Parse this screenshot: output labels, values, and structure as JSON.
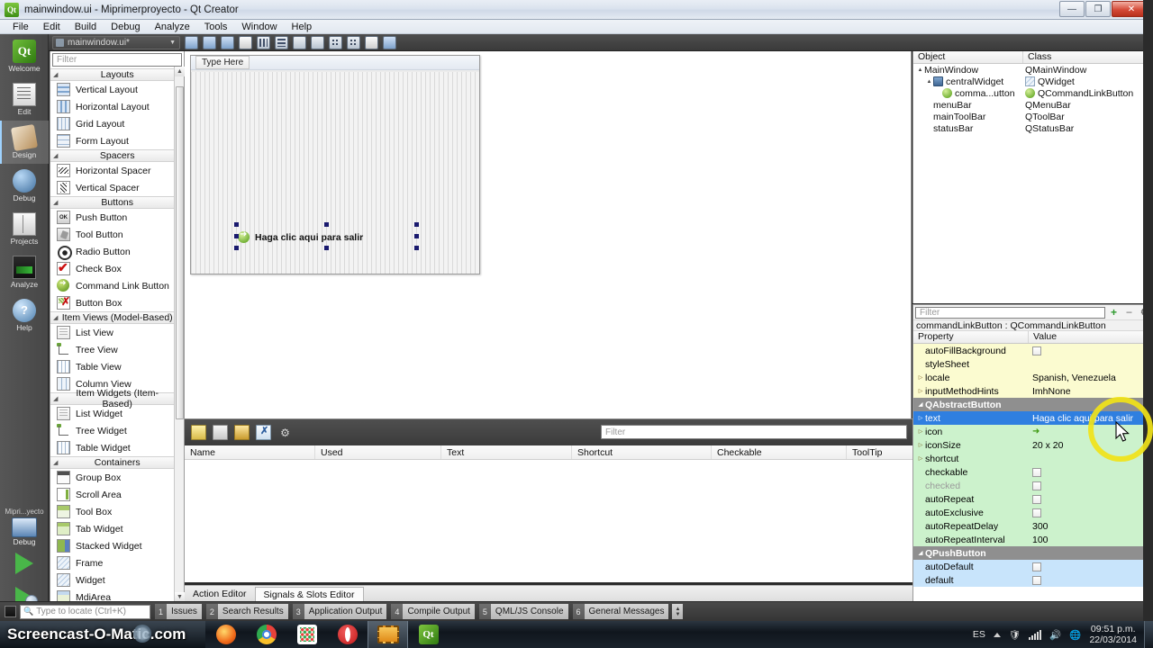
{
  "window": {
    "title": "mainwindow.ui - Miprimerproyecto - Qt Creator",
    "app_icon": "Qt",
    "minimize": "—",
    "maximize": "❐",
    "close": "✕"
  },
  "menubar": {
    "items": [
      "File",
      "Edit",
      "Build",
      "Debug",
      "Analyze",
      "Tools",
      "Window",
      "Help"
    ]
  },
  "editor_toolbar": {
    "file_combo": "mainwindow.ui*",
    "dropdown_arrow": "▼",
    "icons": [
      "adjust-size-icon",
      "lay-out-size-icon",
      "break-layout-icon",
      "save-form-icon",
      "layout-horizontally-icon",
      "layout-vertically-icon",
      "layout-splitter-h-icon",
      "layout-splitter-v-icon",
      "layout-form-icon",
      "layout-grid-icon",
      "preview-icon",
      "edit-widgets-icon"
    ]
  },
  "modebar": {
    "items": [
      {
        "label": "Welcome",
        "icon": "qt-logo-icon",
        "active": false
      },
      {
        "label": "Edit",
        "icon": "document-icon",
        "active": false
      },
      {
        "label": "Design",
        "icon": "brush-icon",
        "active": true
      },
      {
        "label": "Debug",
        "icon": "debug-sphere-icon",
        "active": false
      },
      {
        "label": "Projects",
        "icon": "projects-book-icon",
        "active": false
      },
      {
        "label": "Analyze",
        "icon": "analyze-chart-icon",
        "active": false
      },
      {
        "label": "Help",
        "icon": "help-question-icon",
        "active": false
      }
    ],
    "kit_label": "Mipri...yecto",
    "build_config": "Debug",
    "run_button": "run-icon",
    "debug_button": "start-debugging-icon",
    "build_button": "build-hammer-icon"
  },
  "widget_box": {
    "filter_placeholder": "Filter",
    "sections": [
      {
        "name": "Layouts",
        "items": [
          {
            "label": "Vertical Layout",
            "icon": "vertical-layout-icon",
            "cls": "vlay"
          },
          {
            "label": "Horizontal Layout",
            "icon": "horizontal-layout-icon",
            "cls": "hlay"
          },
          {
            "label": "Grid Layout",
            "icon": "grid-layout-icon",
            "cls": "grid"
          },
          {
            "label": "Form Layout",
            "icon": "form-layout-icon",
            "cls": "form"
          }
        ]
      },
      {
        "name": "Spacers",
        "items": [
          {
            "label": "Horizontal Spacer",
            "icon": "horizontal-spacer-icon",
            "cls": "hsp"
          },
          {
            "label": "Vertical Spacer",
            "icon": "vertical-spacer-icon",
            "cls": "vsp"
          }
        ]
      },
      {
        "name": "Buttons",
        "items": [
          {
            "label": "Push Button",
            "icon": "push-button-icon",
            "cls": "push",
            "glyph": "OK"
          },
          {
            "label": "Tool Button",
            "icon": "tool-button-icon",
            "cls": "tool"
          },
          {
            "label": "Radio Button",
            "icon": "radio-button-icon",
            "cls": "radio"
          },
          {
            "label": "Check Box",
            "icon": "check-box-icon",
            "cls": "check"
          },
          {
            "label": "Command Link Button",
            "icon": "command-link-button-icon",
            "cls": "cmd"
          },
          {
            "label": "Button Box",
            "icon": "button-box-icon",
            "cls": "bbox"
          }
        ]
      },
      {
        "name": "Item Views (Model-Based)",
        "left_aligned": true,
        "items": [
          {
            "label": "List View",
            "icon": "list-view-icon",
            "cls": "listv"
          },
          {
            "label": "Tree View",
            "icon": "tree-view-icon",
            "cls": "treev"
          },
          {
            "label": "Table View",
            "icon": "table-view-icon",
            "cls": "tablev"
          },
          {
            "label": "Column View",
            "icon": "column-view-icon",
            "cls": "colv"
          }
        ]
      },
      {
        "name": "Item Widgets (Item-Based)",
        "left_aligned": true,
        "items": [
          {
            "label": "List Widget",
            "icon": "list-widget-icon",
            "cls": "listv"
          },
          {
            "label": "Tree Widget",
            "icon": "tree-widget-icon",
            "cls": "treev"
          },
          {
            "label": "Table Widget",
            "icon": "table-widget-icon",
            "cls": "tablev"
          }
        ]
      },
      {
        "name": "Containers",
        "items": [
          {
            "label": "Group Box",
            "icon": "group-box-icon",
            "cls": "gbox"
          },
          {
            "label": "Scroll Area",
            "icon": "scroll-area-icon",
            "cls": "scroll"
          },
          {
            "label": "Tool Box",
            "icon": "tool-box-icon",
            "cls": "tbox"
          },
          {
            "label": "Tab Widget",
            "icon": "tab-widget-icon",
            "cls": "tabw"
          },
          {
            "label": "Stacked Widget",
            "icon": "stacked-widget-icon",
            "cls": "stackw"
          },
          {
            "label": "Frame",
            "icon": "frame-icon",
            "cls": "frame"
          },
          {
            "label": "Widget",
            "icon": "widget-icon",
            "cls": "frame"
          },
          {
            "label": "MdiArea",
            "icon": "mdi-area-icon",
            "cls": "mdi"
          }
        ]
      }
    ]
  },
  "designer": {
    "form_menu_placeholder": "Type Here",
    "command_link_button": {
      "text": "Haga clic aqui para salir",
      "icon": "green-arrow-icon",
      "selected": true
    }
  },
  "object_inspector": {
    "headers": [
      "Object",
      "Class"
    ],
    "rows": [
      {
        "object": "MainWindow",
        "cls": "QMainWindow",
        "indent": 0,
        "twisty": "▲",
        "icon": ""
      },
      {
        "object": "centralWidget",
        "cls": "QWidget",
        "indent": 1,
        "twisty": "▲",
        "icon": "cw"
      },
      {
        "object": "comma...utton",
        "cls": "QCommandLinkButton",
        "indent": 2,
        "twisty": "",
        "icon": "cmd"
      },
      {
        "object": "menuBar",
        "cls": "QMenuBar",
        "indent": 1,
        "twisty": "",
        "icon": ""
      },
      {
        "object": "mainToolBar",
        "cls": "QToolBar",
        "indent": 1,
        "twisty": "",
        "icon": ""
      },
      {
        "object": "statusBar",
        "cls": "QStatusBar",
        "indent": 1,
        "twisty": "",
        "icon": ""
      }
    ]
  },
  "property_editor": {
    "filter_placeholder": "Filter",
    "add_button": "+",
    "remove_button": "−",
    "configure_button": "⚙",
    "object_line": "commandLinkButton : QCommandLinkButton",
    "headers": [
      "Property",
      "Value"
    ],
    "rows": [
      {
        "name": "autoFillBackground",
        "value": "",
        "style": "yellow",
        "expand": false,
        "checkbox": true
      },
      {
        "name": "styleSheet",
        "value": "",
        "style": "yellow",
        "expand": false
      },
      {
        "name": "locale",
        "value": "Spanish, Venezuela",
        "style": "yellow",
        "expand": true
      },
      {
        "name": "inputMethodHints",
        "value": "ImhNone",
        "style": "yellow",
        "expand": true
      },
      {
        "name": "QAbstractButton",
        "value": "",
        "style": "group",
        "expand": true
      },
      {
        "name": "text",
        "value": "Haga clic aqui para salir",
        "style": "sel",
        "expand": true
      },
      {
        "name": "icon",
        "value": "",
        "style": "green",
        "expand": true,
        "arrow_icon": true
      },
      {
        "name": "iconSize",
        "value": "20 x 20",
        "style": "green",
        "expand": true
      },
      {
        "name": "shortcut",
        "value": "",
        "style": "green",
        "expand": true
      },
      {
        "name": "checkable",
        "value": "",
        "style": "green",
        "expand": false,
        "checkbox": true
      },
      {
        "name": "checked",
        "value": "",
        "style": "green dim",
        "expand": false,
        "checkbox": true
      },
      {
        "name": "autoRepeat",
        "value": "",
        "style": "green",
        "expand": false,
        "checkbox": true
      },
      {
        "name": "autoExclusive",
        "value": "",
        "style": "green",
        "expand": false,
        "checkbox": true
      },
      {
        "name": "autoRepeatDelay",
        "value": "300",
        "style": "green",
        "expand": false
      },
      {
        "name": "autoRepeatInterval",
        "value": "100",
        "style": "green",
        "expand": false
      },
      {
        "name": "QPushButton",
        "value": "",
        "style": "group",
        "expand": true
      },
      {
        "name": "autoDefault",
        "value": "",
        "style": "blue",
        "expand": false,
        "checkbox": true
      },
      {
        "name": "default",
        "value": "",
        "style": "blue",
        "expand": false,
        "checkbox": true
      }
    ]
  },
  "action_editor": {
    "toolbar_icons": [
      "new-action-icon",
      "copy-action-icon",
      "cut-action-icon",
      "delete-action-icon",
      "configure-icon"
    ],
    "filter_placeholder": "Filter",
    "headers": [
      "Name",
      "Used",
      "Text",
      "Shortcut",
      "Checkable",
      "ToolTip"
    ],
    "rows": [],
    "tabs": [
      {
        "label": "Action Editor",
        "active": true
      },
      {
        "label": "Signals & Slots Editor",
        "active": false
      }
    ]
  },
  "output_bar": {
    "locate_placeholder": "Type to locate (Ctrl+K)",
    "search_icon": "magnifier-icon",
    "panes": [
      {
        "num": "1",
        "label": "Issues"
      },
      {
        "num": "2",
        "label": "Search Results"
      },
      {
        "num": "3",
        "label": "Application Output"
      },
      {
        "num": "4",
        "label": "Compile Output"
      },
      {
        "num": "5",
        "label": "QML/JS Console"
      },
      {
        "num": "6",
        "label": "General Messages"
      }
    ]
  },
  "taskbar": {
    "watermark": "Screencast-O-Matic.com",
    "apps": [
      {
        "name": "firefox-icon",
        "cls": "ic-firefox",
        "active": false
      },
      {
        "name": "chrome-icon",
        "cls": "ic-chrome",
        "active": false
      },
      {
        "name": "apps-icon",
        "cls": "ic-apps",
        "active": false
      },
      {
        "name": "opera-icon",
        "cls": "ic-opera",
        "active": false
      },
      {
        "name": "screencast-o-matic-icon",
        "cls": "ic-som",
        "active": true
      },
      {
        "name": "qt-creator-icon",
        "cls": "ic-qt",
        "active": false
      }
    ],
    "tray": {
      "language": "ES",
      "show_hidden": "▲",
      "icons": [
        "action-center-icon",
        "network-icon",
        "volume-icon",
        "update-icon"
      ],
      "time": "09:51 p.m.",
      "date": "22/03/2014"
    }
  },
  "colors": {
    "accent_selected": "#2f7fe0",
    "highlight_ring": "#f1e318",
    "group_header": "#8f8f8f",
    "prop_yellow": "#fbfbd0",
    "prop_green": "#ccf2cc",
    "prop_blue": "#c8e4fb",
    "qt_green": "#4f9a12"
  }
}
